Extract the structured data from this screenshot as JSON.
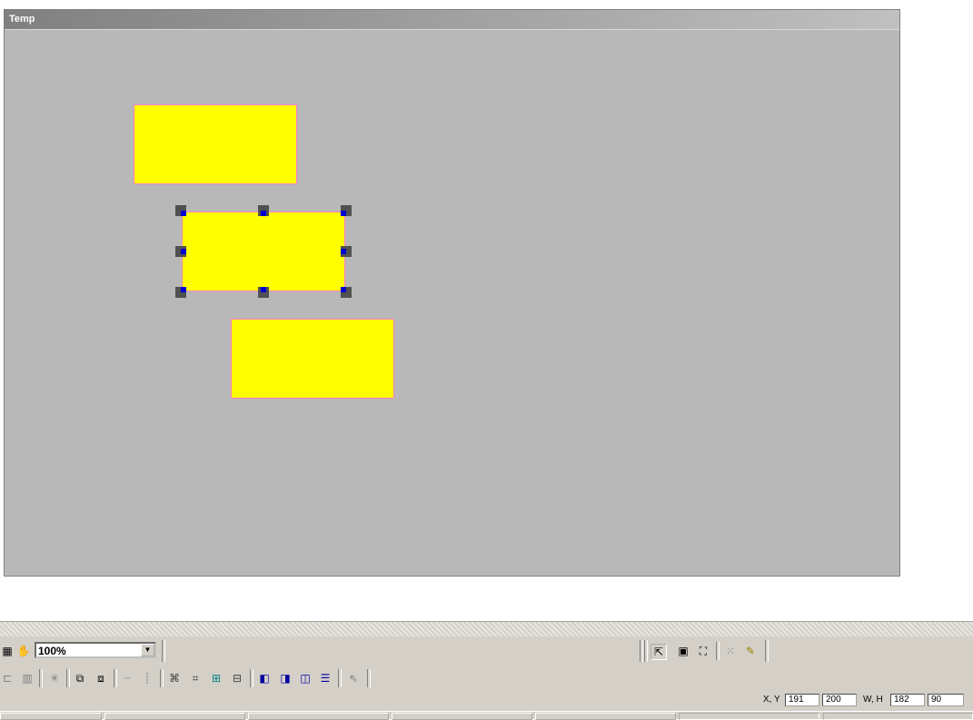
{
  "window": {
    "title": "Temp"
  },
  "toolbar": {
    "zoom_value": "100%",
    "icons": [
      "grid-icon",
      "hand-icon",
      "align-left-icon",
      "align-center-icon",
      "snap-icon",
      "group-icon",
      "ungroup-icon",
      "line-dotted-icon",
      "line-vertical-icon",
      "distribute-h-icon",
      "distribute-v-icon",
      "center-icon",
      "bottom-icon",
      "front-icon",
      "back-icon",
      "order-icon",
      "stack-icon",
      "pointer-icon",
      "properties-icon",
      "window-icon",
      "fullscreen-icon",
      "dots-grid-icon",
      "ruler-icon"
    ]
  },
  "status": {
    "xy_label": "X, Y",
    "x_value": "191",
    "y_value": "200",
    "wh_label": "W, H",
    "w_value": "182",
    "h_value": "90"
  },
  "colors": {
    "canvas": "#b8b8b8",
    "shape_fill": "#ffff00",
    "shape_border": "#ff80c0",
    "handle": "#505050",
    "handle_inner": "#0000d0"
  }
}
